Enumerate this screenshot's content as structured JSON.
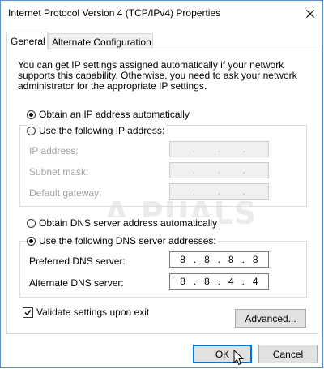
{
  "window": {
    "title": "Internet Protocol Version 4 (TCP/IPv4) Properties"
  },
  "tabs": [
    {
      "label": "General",
      "active": true
    },
    {
      "label": "Alternate Configuration",
      "active": false
    }
  ],
  "description": "You can get IP settings assigned automatically if your network supports this capability. Otherwise, you need to ask your network administrator for the appropriate IP settings.",
  "ip": {
    "auto_label": "Obtain an IP address automatically",
    "auto_selected": true,
    "manual_label": "Use the following IP address:",
    "manual_selected": false,
    "fields": [
      {
        "label": "IP address:",
        "octets": [
          "",
          "",
          "",
          ""
        ]
      },
      {
        "label": "Subnet mask:",
        "octets": [
          "",
          "",
          "",
          ""
        ]
      },
      {
        "label": "Default gateway:",
        "octets": [
          "",
          "",
          "",
          ""
        ]
      }
    ]
  },
  "dns": {
    "auto_label": "Obtain DNS server address automatically",
    "auto_selected": false,
    "manual_label": "Use the following DNS server addresses:",
    "manual_selected": true,
    "preferred_label": "Preferred DNS server:",
    "preferred_octets": [
      "8",
      "8",
      "8",
      "8"
    ],
    "alternate_label": "Alternate DNS server:",
    "alternate_octets": [
      "8",
      "8",
      "4",
      "4"
    ]
  },
  "validate": {
    "label": "Validate settings upon exit",
    "checked": true
  },
  "buttons": {
    "advanced": "Advanced...",
    "ok": "OK",
    "cancel": "Cancel"
  },
  "watermark": "A PUALS",
  "icons": {
    "close": "close-icon",
    "check": "checkmark-icon",
    "cursor": "mouse-cursor-icon"
  }
}
